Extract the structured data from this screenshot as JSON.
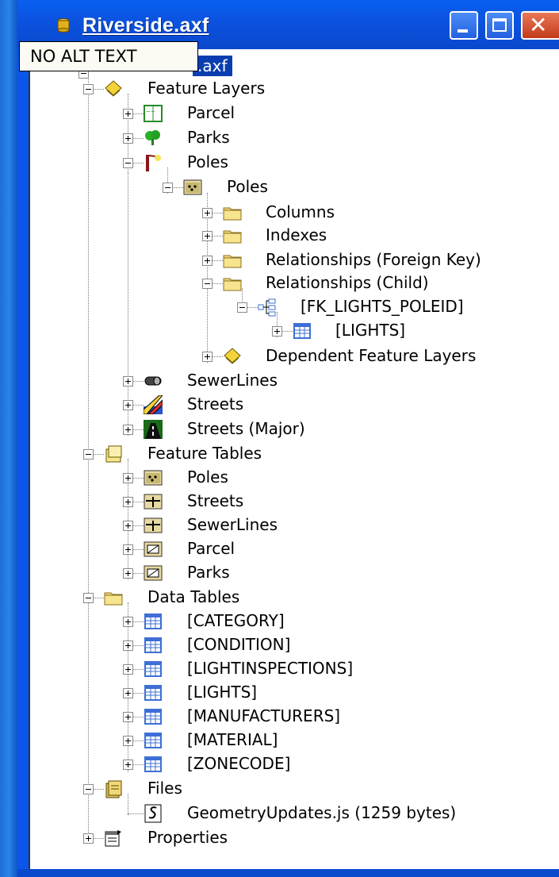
{
  "window": {
    "title": "Riverside.axf",
    "tooltip": "NO ALT TEXT",
    "selected_root_label": ".axf",
    "controls": {
      "minimize": "minimize",
      "maximize": "maximize",
      "close": "close"
    }
  },
  "tree": [
    {
      "id": "feature-layers",
      "label": "Feature Layers",
      "icon": "feature-layers-icon",
      "state": "expanded"
    },
    {
      "id": "parcel",
      "label": "Parcel",
      "icon": "parcel-layer-icon",
      "state": "collapsed"
    },
    {
      "id": "parks",
      "label": "Parks",
      "icon": "parks-tree-icon",
      "state": "collapsed"
    },
    {
      "id": "poles",
      "label": "Poles",
      "icon": "poles-layer-icon",
      "state": "expanded"
    },
    {
      "id": "poles-table",
      "label": "Poles",
      "icon": "point-table-icon",
      "state": "expanded"
    },
    {
      "id": "columns",
      "label": "Columns",
      "icon": "folder-icon",
      "state": "collapsed"
    },
    {
      "id": "indexes",
      "label": "Indexes",
      "icon": "folder-icon",
      "state": "collapsed"
    },
    {
      "id": "rel-fk",
      "label": "Relationships (Foreign Key)",
      "icon": "folder-icon",
      "state": "collapsed"
    },
    {
      "id": "rel-child",
      "label": "Relationships (Child)",
      "icon": "folder-icon",
      "state": "expanded"
    },
    {
      "id": "fk-lights",
      "label": "[FK_LIGHTS_POLEID]",
      "icon": "relationship-icon",
      "state": "expanded"
    },
    {
      "id": "lights-rel",
      "label": "[LIGHTS]",
      "icon": "table-icon",
      "state": "collapsed"
    },
    {
      "id": "dependent-layers",
      "label": "Dependent Feature Layers",
      "icon": "feature-layers-icon",
      "state": "collapsed"
    },
    {
      "id": "sewerlines",
      "label": "SewerLines",
      "icon": "pipe-icon",
      "state": "collapsed"
    },
    {
      "id": "streets",
      "label": "Streets",
      "icon": "streets-icon",
      "state": "collapsed"
    },
    {
      "id": "streets-major",
      "label": "Streets (Major)",
      "icon": "road-icon",
      "state": "collapsed"
    },
    {
      "id": "feature-tables",
      "label": "Feature Tables",
      "icon": "feature-tables-icon",
      "state": "expanded"
    },
    {
      "id": "ft-poles",
      "label": "Poles",
      "icon": "point-table-icon",
      "state": "collapsed"
    },
    {
      "id": "ft-streets",
      "label": "Streets",
      "icon": "line-table-icon",
      "state": "collapsed"
    },
    {
      "id": "ft-sewerlines",
      "label": "SewerLines",
      "icon": "line-table-icon",
      "state": "collapsed"
    },
    {
      "id": "ft-parcel",
      "label": "Parcel",
      "icon": "polygon-table-icon",
      "state": "collapsed"
    },
    {
      "id": "ft-parks",
      "label": "Parks",
      "icon": "polygon-table-icon",
      "state": "collapsed"
    },
    {
      "id": "data-tables",
      "label": "Data Tables",
      "icon": "folder-icon",
      "state": "expanded"
    },
    {
      "id": "dt-category",
      "label": "[CATEGORY]",
      "icon": "table-icon",
      "state": "collapsed"
    },
    {
      "id": "dt-condition",
      "label": "[CONDITION]",
      "icon": "table-icon",
      "state": "collapsed"
    },
    {
      "id": "dt-lightinspections",
      "label": "[LIGHTINSPECTIONS]",
      "icon": "table-icon",
      "state": "collapsed"
    },
    {
      "id": "dt-lights",
      "label": "[LIGHTS]",
      "icon": "table-icon",
      "state": "collapsed"
    },
    {
      "id": "dt-manufacturers",
      "label": "[MANUFACTURERS]",
      "icon": "table-icon",
      "state": "collapsed"
    },
    {
      "id": "dt-material",
      "label": "[MATERIAL]",
      "icon": "table-icon",
      "state": "collapsed"
    },
    {
      "id": "dt-zonecode",
      "label": "[ZONECODE]",
      "icon": "table-icon",
      "state": "collapsed"
    },
    {
      "id": "files",
      "label": "Files",
      "icon": "files-icon",
      "state": "expanded"
    },
    {
      "id": "geometry-js",
      "label": "GeometryUpdates.js (1259 bytes)",
      "icon": "script-file-icon",
      "state": "leaf"
    },
    {
      "id": "properties",
      "label": "Properties",
      "icon": "properties-icon",
      "state": "collapsed"
    }
  ],
  "colors": {
    "titlebar": "#0b53e0",
    "selection": "#0a3eb0",
    "folder": "#f1d97a",
    "table_blue": "#3d6fd6",
    "close_button": "#c33a18"
  }
}
